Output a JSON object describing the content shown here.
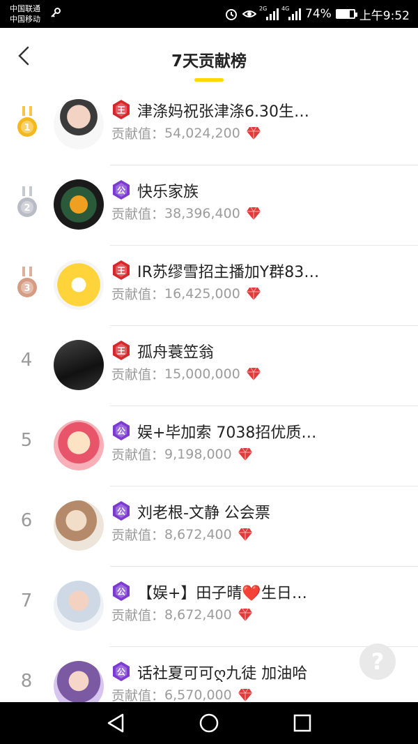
{
  "status_bar": {
    "carrier_1": "中国联通",
    "carrier_2": "中国移动",
    "network_label_1": "2G",
    "network_label_2": "4G",
    "battery_percent": "74%",
    "battery_level": 0.74,
    "time": "上午9:52"
  },
  "header": {
    "title": "7天贡献榜",
    "accent_color": "#ffd800"
  },
  "colors": {
    "badge_red": "#d6272c",
    "badge_purple": "#7c3ad1",
    "gem_red": "#e03a3a",
    "gold": "#f5b81c",
    "silver": "#b8bcc4",
    "bronze": "#d59b83"
  },
  "contrib_label": "贡献值：",
  "rows": [
    {
      "rank": "1",
      "medal": "gold",
      "badge": "王",
      "badge_type": "red",
      "name": "津涤妈祝张津涤6.30生…",
      "value": "54,024,200"
    },
    {
      "rank": "2",
      "medal": "silver",
      "badge": "公",
      "badge_type": "purple",
      "name": "快乐家族",
      "value": "38,396,400"
    },
    {
      "rank": "3",
      "medal": "bronze",
      "badge": "王",
      "badge_type": "red",
      "name": "IR苏缪雪招主播加Y群83…",
      "value": "16,425,000"
    },
    {
      "rank": "4",
      "medal": "",
      "badge": "王",
      "badge_type": "red",
      "name": "孤舟蓑笠翁",
      "value": "15,000,000"
    },
    {
      "rank": "5",
      "medal": "",
      "badge": "公",
      "badge_type": "purple",
      "name": "娱+毕加索 7038招优质…",
      "value": "9,198,000"
    },
    {
      "rank": "6",
      "medal": "",
      "badge": "公",
      "badge_type": "purple",
      "name": "刘老根-文静 公会票",
      "value": "8,672,400"
    },
    {
      "rank": "7",
      "medal": "",
      "badge": "公",
      "badge_type": "purple",
      "name": "【娱+】田子晴❤️生日…",
      "value": "8,672,400"
    },
    {
      "rank": "8",
      "medal": "",
      "badge": "公",
      "badge_type": "purple",
      "name": "话社夏可可ღ九徒 加油哈",
      "value": "6,570,000"
    }
  ],
  "help_fab": {
    "label": "?"
  },
  "icons": {
    "back": "chevron-left-icon",
    "alarm": "alarm-icon",
    "eye": "eye-icon",
    "key": "key-icon",
    "nav_back": "triangle-back-icon",
    "nav_home": "circle-home-icon",
    "nav_recent": "square-recent-icon"
  }
}
